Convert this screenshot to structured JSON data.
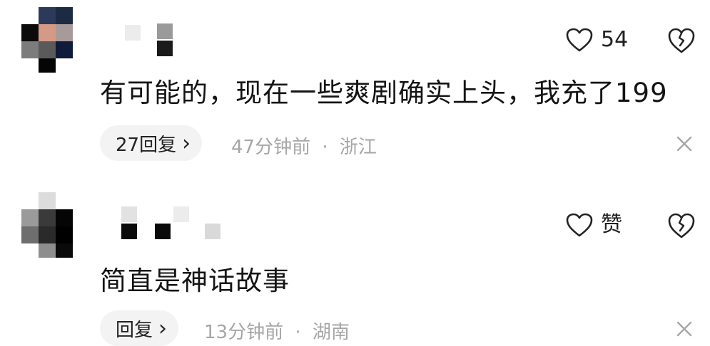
{
  "comments": [
    {
      "text": "有可能的，现在一些爽剧确实上头，我充了199",
      "like_label": "54",
      "reply_label": "27回复",
      "reply_chevron": "›",
      "time": "47分钟前",
      "separator": "·",
      "location": "浙江"
    },
    {
      "text": "简直是神话故事",
      "like_label": "赞",
      "reply_label": "回复",
      "reply_chevron": "›",
      "time": "13分钟前",
      "separator": "·",
      "location": "湖南"
    }
  ],
  "colors": {
    "text": "#141414",
    "meta": "#a6a6a6",
    "reply_bg": "#f3f3f3",
    "icon": "#222222"
  },
  "icons": [
    "avatar-pixelated",
    "heart-outline-icon",
    "broken-heart-icon",
    "chevron-right-icon",
    "close-icon"
  ]
}
